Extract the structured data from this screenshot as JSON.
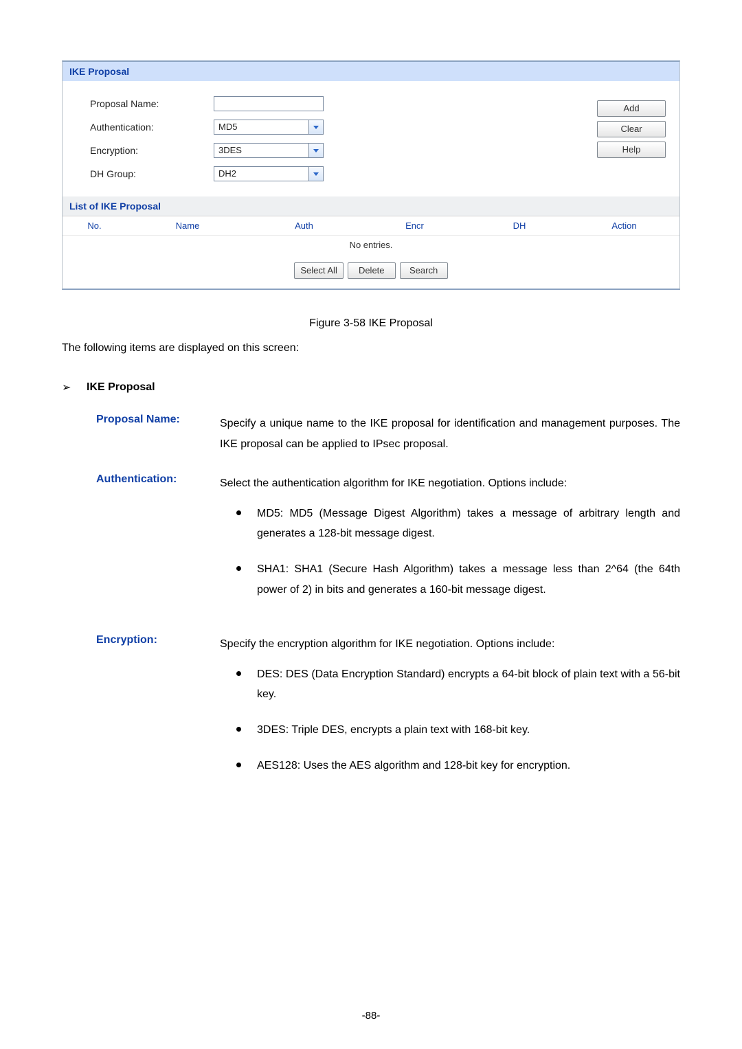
{
  "panel": {
    "title": "IKE Proposal",
    "form": {
      "proposal_name_label": "Proposal Name:",
      "proposal_name_value": "",
      "authentication_label": "Authentication:",
      "authentication_value": "MD5",
      "encryption_label": "Encryption:",
      "encryption_value": "3DES",
      "dh_group_label": "DH Group:",
      "dh_group_value": "DH2"
    },
    "buttons": {
      "add": "Add",
      "clear": "Clear",
      "help": "Help"
    },
    "list_title": "List of IKE Proposal",
    "columns": {
      "no": "No.",
      "name": "Name",
      "auth": "Auth",
      "encr": "Encr",
      "dh": "DH",
      "action": "Action"
    },
    "no_entries": "No entries.",
    "footer_buttons": {
      "select_all": "Select All",
      "delete": "Delete",
      "search": "Search"
    }
  },
  "figure_caption": "Figure 3-58 IKE Proposal",
  "intro_line": "The following items are displayed on this screen:",
  "section_heading": "IKE Proposal",
  "defs": {
    "proposal_name": {
      "term": "Proposal Name:",
      "text": "Specify a unique name to the IKE proposal for identification and management purposes. The IKE proposal can be applied to IPsec proposal."
    },
    "authentication": {
      "term": "Authentication:",
      "text": "Select the authentication algorithm for IKE negotiation. Options include:",
      "items": [
        "MD5: MD5 (Message Digest Algorithm) takes a message of arbitrary length and generates a 128-bit message digest.",
        "SHA1: SHA1 (Secure Hash Algorithm) takes a message less than 2^64 (the 64th power of 2) in bits and generates a 160-bit message digest."
      ]
    },
    "encryption": {
      "term": "Encryption:",
      "text": "Specify the encryption algorithm for IKE negotiation. Options include:",
      "items": [
        "DES: DES (Data Encryption Standard) encrypts a 64-bit block of plain text with a 56-bit key.",
        "3DES: Triple DES, encrypts a plain text with 168-bit key.",
        "AES128: Uses the AES algorithm and 128-bit key for encryption."
      ]
    }
  },
  "page_number": "-88-"
}
